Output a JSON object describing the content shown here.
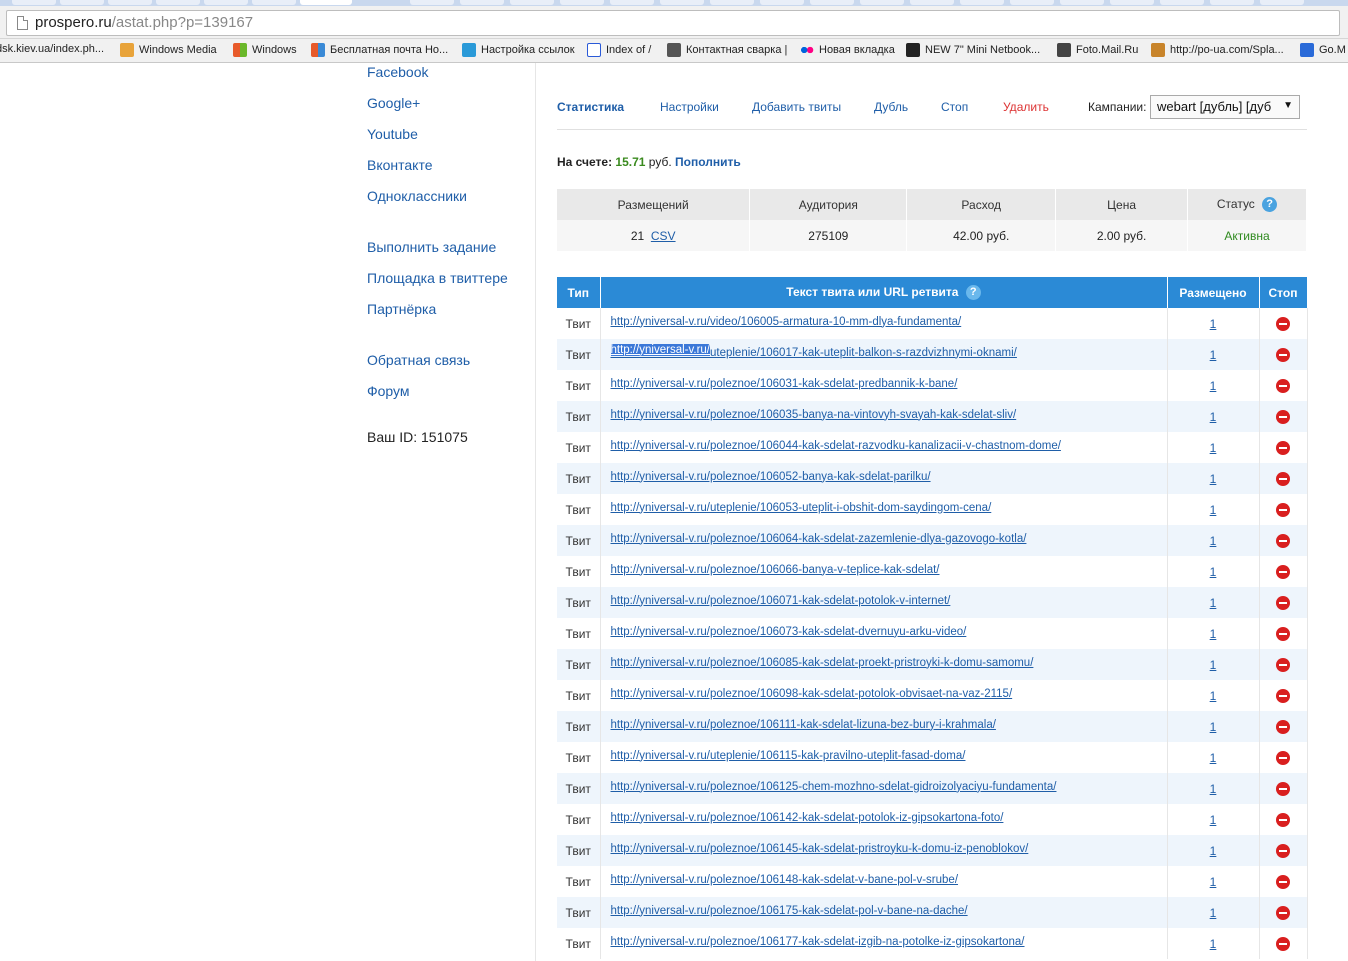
{
  "browser": {
    "url_host": "prospero.ru",
    "url_path": "/astat.php?p=139167",
    "bookmarks": [
      {
        "label": "dsk.kiev.ua/index.ph...",
        "icon": "page-icon",
        "color": "#ffffff"
      },
      {
        "label": "Windows Media",
        "icon": "windows-media-icon",
        "color": "#e8a33a"
      },
      {
        "label": "Windows",
        "icon": "windows-icon",
        "color": "#3a8ad6"
      },
      {
        "label": "Бесплатная почта Но...",
        "icon": "windows-icon",
        "color": "#e85a2a"
      },
      {
        "label": "Настройка ссылок",
        "icon": "windows-icon",
        "color": "#2a9ad8"
      },
      {
        "label": "Index of /",
        "icon": "page-icon",
        "color": "#2a5ad8"
      },
      {
        "label": "Контактная сварка |",
        "icon": "site-icon",
        "color": "#555555"
      },
      {
        "label": "Новая вкладка",
        "icon": "flickr-icon",
        "color": "#ff0084"
      },
      {
        "label": "NEW 7\" Mini Netbook...",
        "icon": "bag-icon",
        "color": "#222222"
      },
      {
        "label": "Foto.Mail.Ru",
        "icon": "camera-icon",
        "color": "#444444"
      },
      {
        "label": "http://po-ua.com/Spla...",
        "icon": "site-icon",
        "color": "#c8842a"
      },
      {
        "label": "Go.M",
        "icon": "search-icon",
        "color": "#2a6ad8"
      }
    ]
  },
  "sidebar": {
    "links": [
      "Facebook",
      "Google+",
      "Youtube",
      "Вконтакте",
      "Одноклассники",
      "Выполнить задание",
      "Площадка в твиттере",
      "Партнёрка",
      "Обратная связь",
      "Форум"
    ],
    "user_id": "Ваш ID: 151075"
  },
  "nav": {
    "items": [
      "Статистика",
      "Настройки",
      "Добавить твиты",
      "Дубль",
      "Стоп",
      "Удалить"
    ],
    "campaign_label": "Кампании:",
    "campaign_value": "webart [дубль] [дуб"
  },
  "balance": {
    "label": "На счете:",
    "amount": "15.71",
    "currency": "руб.",
    "topup": "Пополнить"
  },
  "stats": {
    "headers": [
      "Размещений",
      "Аудитория",
      "Расход",
      "Цена",
      "Статус"
    ],
    "placements": "21",
    "csv": "CSV",
    "audience": "275109",
    "spend": "42.00 руб.",
    "price": "2.00 руб.",
    "status": "Активна"
  },
  "tweets": {
    "headers": {
      "type": "Тип",
      "text": "Текст твита или URL ретвита",
      "placed": "Размещено",
      "stop": "Стоп"
    },
    "selected_prefix": "http://yniversal-v.ru/",
    "rows": [
      {
        "type": "Твит",
        "url": "http://yniversal-v.ru/video/106005-armatura-10-mm-dlya-fundamenta/",
        "placed": "1"
      },
      {
        "type": "Твит",
        "url": "uteplenie/106017-kak-uteplit-balkon-s-razdvizhnymi-oknami/",
        "placed": "1"
      },
      {
        "type": "Твит",
        "url": "http://yniversal-v.ru/poleznoe/106031-kak-sdelat-predbannik-k-bane/",
        "placed": "1"
      },
      {
        "type": "Твит",
        "url": "http://yniversal-v.ru/poleznoe/106035-banya-na-vintovyh-svayah-kak-sdelat-sliv/",
        "placed": "1"
      },
      {
        "type": "Твит",
        "url": "http://yniversal-v.ru/poleznoe/106044-kak-sdelat-razvodku-kanalizacii-v-chastnom-dome/",
        "placed": "1"
      },
      {
        "type": "Твит",
        "url": "http://yniversal-v.ru/poleznoe/106052-banya-kak-sdelat-parilku/",
        "placed": "1"
      },
      {
        "type": "Твит",
        "url": "http://yniversal-v.ru/uteplenie/106053-uteplit-i-obshit-dom-saydingom-cena/",
        "placed": "1"
      },
      {
        "type": "Твит",
        "url": "http://yniversal-v.ru/poleznoe/106064-kak-sdelat-zazemlenie-dlya-gazovogo-kotla/",
        "placed": "1"
      },
      {
        "type": "Твит",
        "url": "http://yniversal-v.ru/poleznoe/106066-banya-v-teplice-kak-sdelat/",
        "placed": "1"
      },
      {
        "type": "Твит",
        "url": "http://yniversal-v.ru/poleznoe/106071-kak-sdelat-potolok-v-internet/",
        "placed": "1"
      },
      {
        "type": "Твит",
        "url": "http://yniversal-v.ru/poleznoe/106073-kak-sdelat-dvernuyu-arku-video/",
        "placed": "1"
      },
      {
        "type": "Твит",
        "url": "http://yniversal-v.ru/poleznoe/106085-kak-sdelat-proekt-pristroyki-k-domu-samomu/",
        "placed": "1"
      },
      {
        "type": "Твит",
        "url": "http://yniversal-v.ru/poleznoe/106098-kak-sdelat-potolok-obvisaet-na-vaz-2115/",
        "placed": "1"
      },
      {
        "type": "Твит",
        "url": "http://yniversal-v.ru/poleznoe/106111-kak-sdelat-lizuna-bez-bury-i-krahmala/",
        "placed": "1"
      },
      {
        "type": "Твит",
        "url": "http://yniversal-v.ru/uteplenie/106115-kak-pravilno-uteplit-fasad-doma/",
        "placed": "1"
      },
      {
        "type": "Твит",
        "url": "http://yniversal-v.ru/poleznoe/106125-chem-mozhno-sdelat-gidroizolyaciyu-fundamenta/",
        "placed": "1"
      },
      {
        "type": "Твит",
        "url": "http://yniversal-v.ru/poleznoe/106142-kak-sdelat-potolok-iz-gipsokartona-foto/",
        "placed": "1"
      },
      {
        "type": "Твит",
        "url": "http://yniversal-v.ru/poleznoe/106145-kak-sdelat-pristroyku-k-domu-iz-penoblokov/",
        "placed": "1"
      },
      {
        "type": "Твит",
        "url": "http://yniversal-v.ru/poleznoe/106148-kak-sdelat-v-bane-pol-v-srube/",
        "placed": "1"
      },
      {
        "type": "Твит",
        "url": "http://yniversal-v.ru/poleznoe/106175-kak-sdelat-pol-v-bane-na-dache/",
        "placed": "1"
      },
      {
        "type": "Твит",
        "url": "http://yniversal-v.ru/poleznoe/106177-kak-sdelat-izgib-na-potolke-iz-gipsokartona/",
        "placed": "1"
      }
    ]
  }
}
